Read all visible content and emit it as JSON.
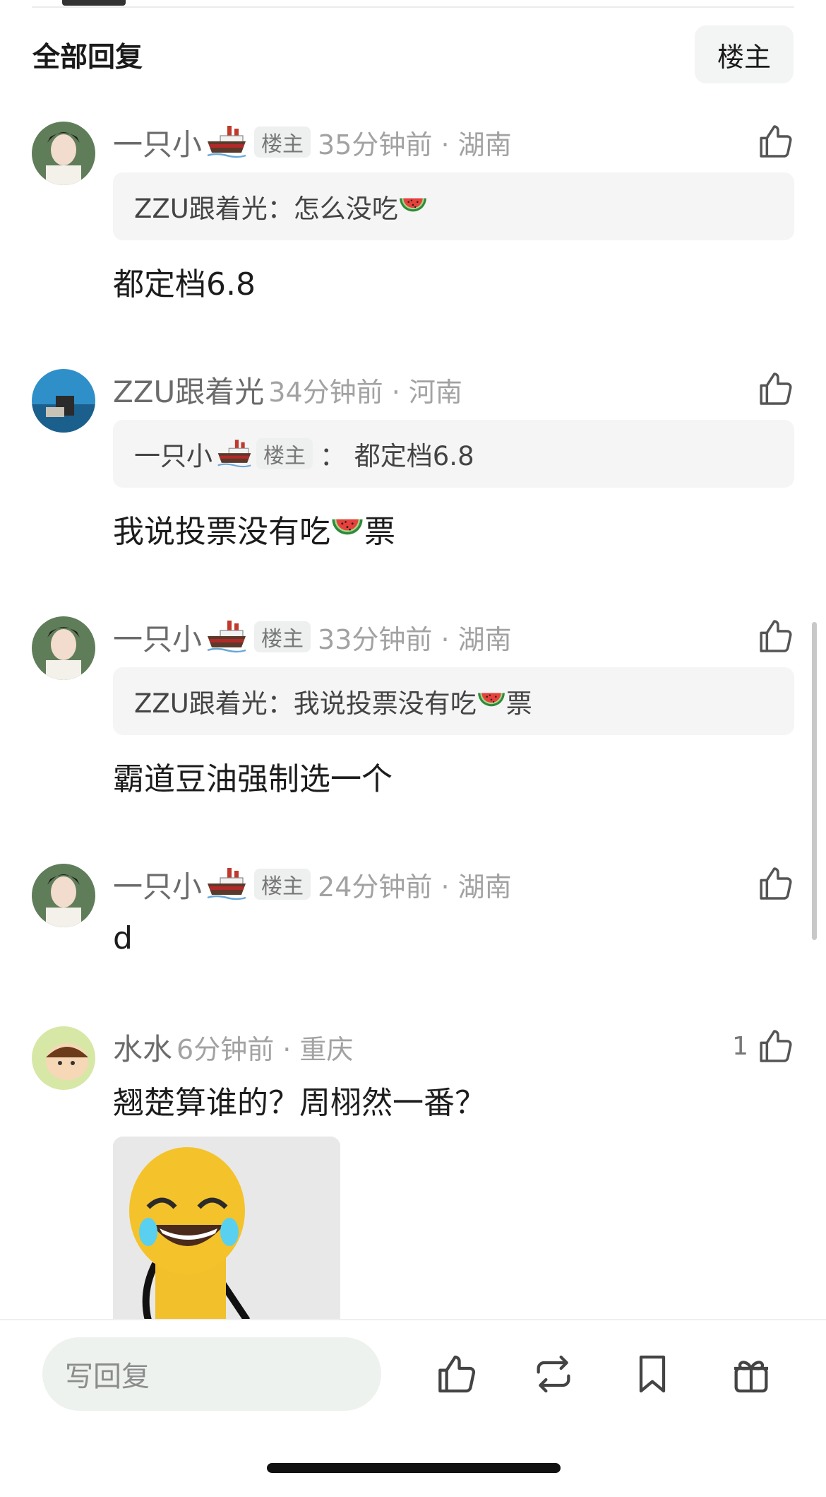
{
  "header": {
    "section_title": "全部回复",
    "owner_filter_label": "楼主"
  },
  "comments": [
    {
      "username": "一只小",
      "owner_badge": "楼主",
      "time_location": "35分钟前 · 湖南",
      "quote_author": "ZZU跟着光：",
      "quote_text": "怎么没吃",
      "text": "都定档6.8"
    },
    {
      "username": "ZZU跟着光",
      "time_location": "34分钟前 · 河南",
      "quote_author": "一只小",
      "quote_badge": "楼主",
      "quote_text": "： 都定档6.8",
      "text_before": "我说投票没有吃",
      "text_after": "票"
    },
    {
      "username": "一只小",
      "owner_badge": "楼主",
      "time_location": "33分钟前 · 湖南",
      "quote_author": "ZZU跟着光：",
      "quote_text": "我说投票没有吃",
      "quote_text_after": "票",
      "text": "霸道豆油强制选一个"
    },
    {
      "username": "一只小",
      "owner_badge": "楼主",
      "time_location": "24分钟前 · 湖南",
      "text": "d"
    },
    {
      "username": "水水",
      "time_location": "6分钟前 · 重庆",
      "like_count": "1",
      "text": "翘楚算谁的？周栩然一番？"
    }
  ],
  "bottom_bar": {
    "reply_placeholder": "写回复",
    "icons": [
      "thumbs-up-icon",
      "repost-icon",
      "bookmark-icon",
      "gift-icon"
    ]
  },
  "colors": {
    "meta_gray": "#9a9a9a",
    "quote_bg": "#f5f5f6",
    "reply_input_bg": "#edf2ee"
  }
}
